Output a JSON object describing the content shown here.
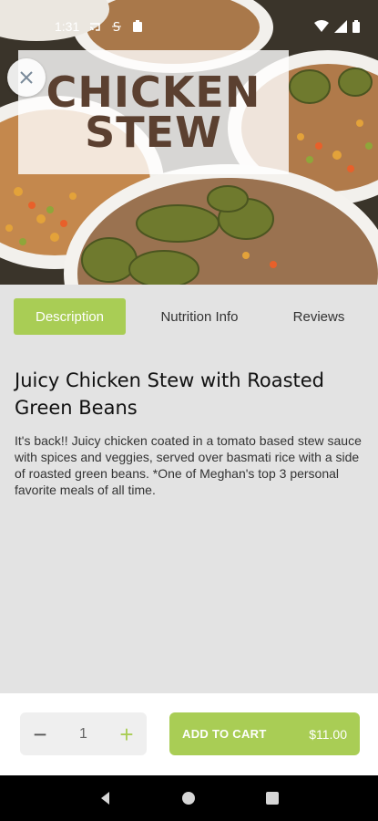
{
  "status_bar": {
    "time": "1:31",
    "icons": [
      "cast-icon",
      "s-app-icon",
      "clipboard-icon"
    ],
    "right_icons": [
      "wifi-icon",
      "signal-icon",
      "battery-icon"
    ]
  },
  "hero": {
    "title_line1": "CHICKEN",
    "title_line2": "STEW",
    "close_icon": "close-icon"
  },
  "tabs": [
    {
      "label": "Description",
      "active": true
    },
    {
      "label": "Nutrition Info",
      "active": false
    },
    {
      "label": "Reviews",
      "active": false
    }
  ],
  "product": {
    "title": "Juicy Chicken Stew with Roasted Green Beans",
    "description": "It's back!! Juicy chicken coated in a tomato based stew sauce with spices and veggies, served over basmati rice with a side of roasted green beans. *One of Meghan's top 3 personal favorite meals of all time."
  },
  "cart": {
    "minus": "−",
    "quantity": "1",
    "plus": "+",
    "add_label": "ADD TO CART",
    "price": "$11.00"
  },
  "colors": {
    "accent": "#a9cd55",
    "title_brown": "#5b4030",
    "background": "#e3e3e3"
  },
  "nav": {
    "back": "back-icon",
    "home": "home-icon",
    "recents": "recents-icon"
  }
}
